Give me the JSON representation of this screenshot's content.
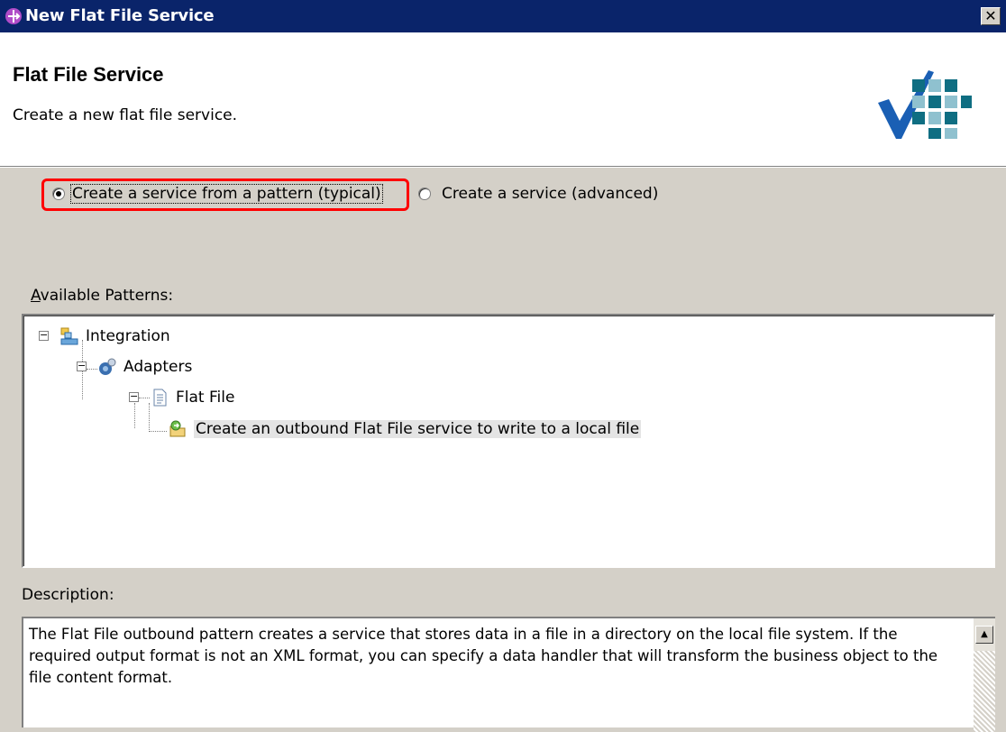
{
  "window": {
    "title": "New Flat File Service",
    "close_glyph": "✕"
  },
  "header": {
    "title": "Flat File Service",
    "subtitle": "Create a new flat file service."
  },
  "options": {
    "pattern_radio": {
      "label": "Create a service from a pattern (typical)",
      "checked": true
    },
    "advanced_radio": {
      "label": "Create a service (advanced)",
      "checked": false
    }
  },
  "patterns": {
    "label_accel": "A",
    "label_rest": "vailable Patterns:",
    "tree": [
      {
        "label": "Integration",
        "icon": "integration-icon",
        "expanded": true
      },
      {
        "label": "Adapters",
        "icon": "adapters-icon",
        "expanded": true
      },
      {
        "label": "Flat File",
        "icon": "document-icon",
        "expanded": true
      },
      {
        "label": "Create an outbound Flat File service to write to a local file",
        "icon": "outbound-service-icon",
        "selected": true
      }
    ]
  },
  "description": {
    "label": "Description:",
    "text": "The Flat File outbound pattern creates a service that stores data in a file in a directory on the local file system. If the required output format is not an XML format, you can specify a data handler that will transform the business object to the file content format."
  },
  "colors": {
    "titlebar": "#0a246a",
    "highlight_border": "#ff0000",
    "dialog_bg": "#d4d0c8"
  }
}
